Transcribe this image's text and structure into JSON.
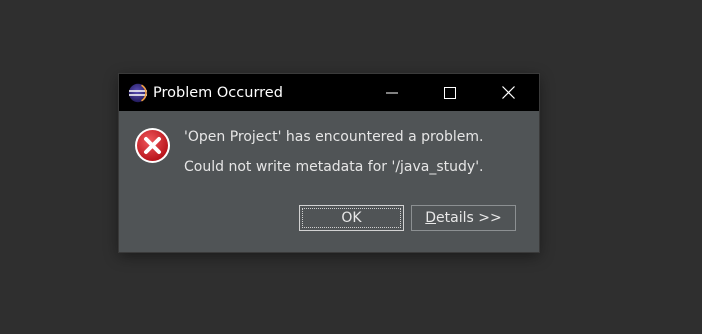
{
  "window": {
    "title": "Problem Occurred"
  },
  "icons": {
    "app": "eclipse-icon",
    "minimize": "minimize-icon",
    "maximize": "maximize-icon",
    "close": "close-icon",
    "error": "error-icon"
  },
  "message": {
    "headline": "'Open Project' has encountered a problem.",
    "detail": "Could not write metadata for '/java_study'."
  },
  "buttons": {
    "ok_label": "OK",
    "details_mnemonic": "D",
    "details_rest": "etails >>"
  },
  "colors": {
    "desktop_bg": "#2f2f2f",
    "titlebar_bg": "#000000",
    "dialog_bg": "#505456",
    "error_red": "#d21f26"
  }
}
